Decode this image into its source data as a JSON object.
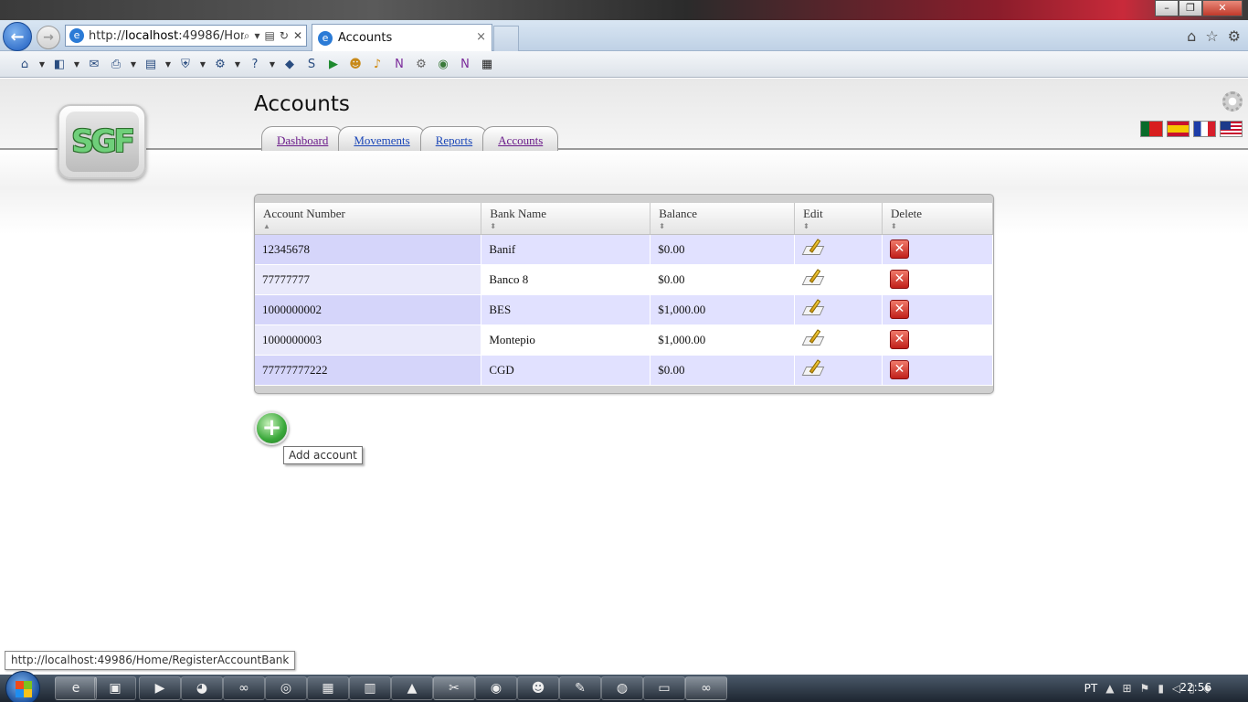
{
  "browser": {
    "address_url_prefix": "http://",
    "address_url_host": "localhost",
    "address_url_rest": ":49986/Home",
    "tab_title": "Accounts",
    "tab_close": "×",
    "status_url": "http://localhost:49986/Home/RegisterAccountBank"
  },
  "page": {
    "title": "Accounts",
    "nav_tabs": [
      {
        "label": "Dashboard"
      },
      {
        "label": "Movements"
      },
      {
        "label": "Reports"
      },
      {
        "label": "Accounts"
      }
    ]
  },
  "table": {
    "headers": {
      "account_number": "Account Number",
      "bank_name": "Bank Name",
      "balance": "Balance",
      "edit": "Edit",
      "delete": "Delete"
    },
    "rows": [
      {
        "account_number": "12345678",
        "bank_name": "Banif",
        "balance": "$0.00"
      },
      {
        "account_number": "77777777",
        "bank_name": "Banco 8",
        "balance": "$0.00"
      },
      {
        "account_number": "1000000002",
        "bank_name": "BES",
        "balance": "$1,000.00"
      },
      {
        "account_number": "1000000003",
        "bank_name": "Montepio",
        "balance": "$1,000.00"
      },
      {
        "account_number": "77777777222",
        "bank_name": "CGD",
        "balance": "$0.00"
      }
    ]
  },
  "add_account": {
    "tooltip": "Add account"
  },
  "taskbar": {
    "language": "PT",
    "time": "22:56"
  },
  "logo_text": "SGF"
}
